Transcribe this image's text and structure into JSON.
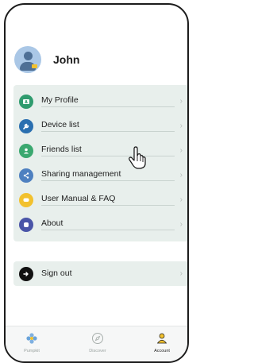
{
  "user": {
    "name": "John"
  },
  "menu": {
    "items": [
      {
        "label": "My Profile",
        "icon": "profile-card-icon",
        "color": "#2f9b6e"
      },
      {
        "label": "Device list",
        "icon": "wrench-icon",
        "color": "#2a6fb0"
      },
      {
        "label": "Friends list",
        "icon": "person-icon",
        "color": "#3aa86f"
      },
      {
        "label": "Sharing management",
        "icon": "share-icon",
        "color": "#4e80c0"
      },
      {
        "label": "User Manual & FAQ",
        "icon": "chat-bubble-icon",
        "color": "#f2c12e"
      },
      {
        "label": "About",
        "icon": "info-icon",
        "color": "#4a55a8"
      }
    ]
  },
  "signout": {
    "label": "Sign out",
    "icon": "exit-icon"
  },
  "tabs": [
    {
      "label": "Pumpkit",
      "icon": "flower-icon",
      "active": false
    },
    {
      "label": "Discover",
      "icon": "compass-icon",
      "active": false
    },
    {
      "label": "Account",
      "icon": "account-icon",
      "active": true
    }
  ],
  "colors": {
    "card_bg": "#e8efec",
    "accent_yellow": "#f2c12e",
    "avatar_bg": "#aac7e6"
  }
}
